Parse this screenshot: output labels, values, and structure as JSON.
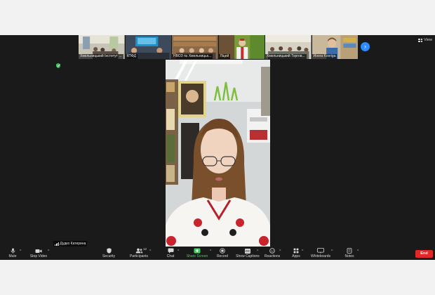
{
  "view_button": {
    "label": "View",
    "icon": "grid-icon"
  },
  "participants_strip": [
    {
      "name": "Хмельницький Інститут ..."
    },
    {
      "name": "КПФД"
    },
    {
      "name": "НВОЗ № Хмельницьк..."
    },
    {
      "name": "Ліцей"
    },
    {
      "name": "Хмельницький Торгов..."
    },
    {
      "name": "Йонга Kovrigа"
    }
  ],
  "active_speaker": {
    "name": "Дудко Катерина"
  },
  "toolbar": {
    "mute": "Mute",
    "stop_video": "Stop Video",
    "security": "Security",
    "participants": "Participants",
    "participants_count": "12",
    "chat": "Chat",
    "share_screen": "Share Screen",
    "record": "Record",
    "show_captions": "Show Captions",
    "captions_badge": "CC",
    "reactions": "Reactions",
    "apps": "Apps",
    "whiteboards": "Whiteboards",
    "notes": "Notes",
    "end": "End"
  },
  "colors": {
    "accent": "#2d8cff",
    "share_green": "#3dd15f",
    "end_red": "#e02828",
    "background": "#1a1a1a"
  }
}
